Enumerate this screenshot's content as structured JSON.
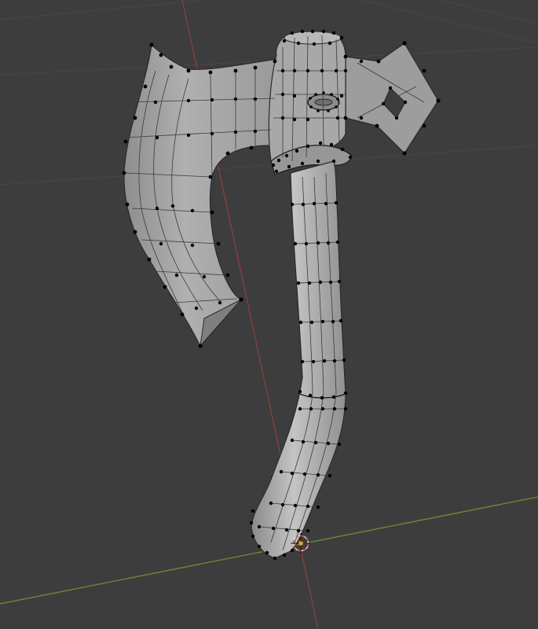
{
  "viewport": {
    "background": "#3d3d3d",
    "grid_color": "#4a4a4a",
    "x_axis_color": "#6b8a33",
    "y_axis_color": "#8a3c3c",
    "mesh_fill": "#a6a6a6",
    "mesh_shadow": "#7d7d7d",
    "mesh_highlight": "#c2c2c2",
    "edge_color": "#2a2a2a",
    "vertex_color": "#000000",
    "cursor_ring_color": "#d8d8d8",
    "cursor_dash_color": "#d44c4c",
    "origin_color": "#ff9a1f"
  },
  "scene": {
    "object": "axe-mesh",
    "mode": "edit-mode",
    "show_wireframe": true,
    "show_vertices": true
  }
}
